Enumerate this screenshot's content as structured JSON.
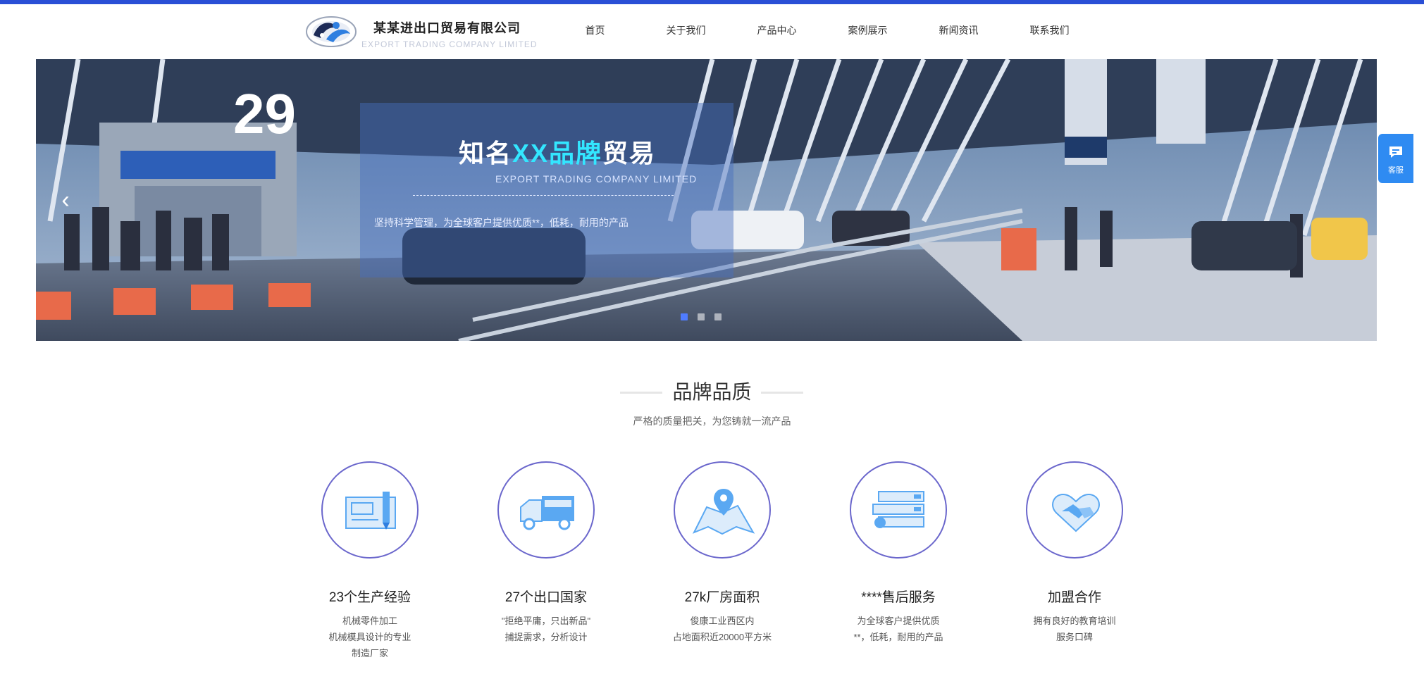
{
  "header": {
    "company_name": "某某进出口贸易有限公司",
    "company_en": "EXPORT TRADING COMPANY LIMITED"
  },
  "nav": {
    "items": [
      "首页",
      "关于我们",
      "产品中心",
      "案例展示",
      "新闻资讯",
      "联系我们"
    ]
  },
  "banner": {
    "headline_prefix": "知名",
    "headline_accent": "XX品牌",
    "headline_suffix": "贸易",
    "subtitle": "EXPORT TRADING COMPANY LIMITED",
    "description": "坚持科学管理，为全球客户提供优质**，低耗，耐用的产品",
    "gate_number": "29",
    "active_slide": 1,
    "slide_count": 3
  },
  "side_widget": {
    "label": "客服"
  },
  "section": {
    "title": "品牌品质",
    "subtitle": "严格的质量把关，为您铸就一流产品"
  },
  "features": [
    {
      "icon": "blueprint-icon",
      "title": "23个生产经验",
      "lines": [
        "机械零件加工",
        "机械模具设计的专业",
        "制造厂家"
      ]
    },
    {
      "icon": "truck-icon",
      "title": "27个出口国家",
      "lines": [
        "\"拒绝平庸，只出新品\"",
        "捕捉需求，分析设计"
      ]
    },
    {
      "icon": "map-pin-icon",
      "title": "27k厂房面积",
      "lines": [
        "俊康工业西区内",
        "占地面积近20000平方米"
      ]
    },
    {
      "icon": "service-card-icon",
      "title": "****售后服务",
      "lines": [
        "为全球客户提供优质",
        "**，低耗，耐用的产品"
      ]
    },
    {
      "icon": "handshake-icon",
      "title": "加盟合作",
      "lines": [
        "拥有良好的教育培训",
        "服务口碑"
      ]
    }
  ],
  "colors": {
    "top_strip": "#2a4fd6",
    "accent_cyan": "#33e6ff",
    "circle_border": "#6b67cc",
    "icon_blue": "#5aa8f2",
    "side_widget": "#2f8bf2"
  }
}
